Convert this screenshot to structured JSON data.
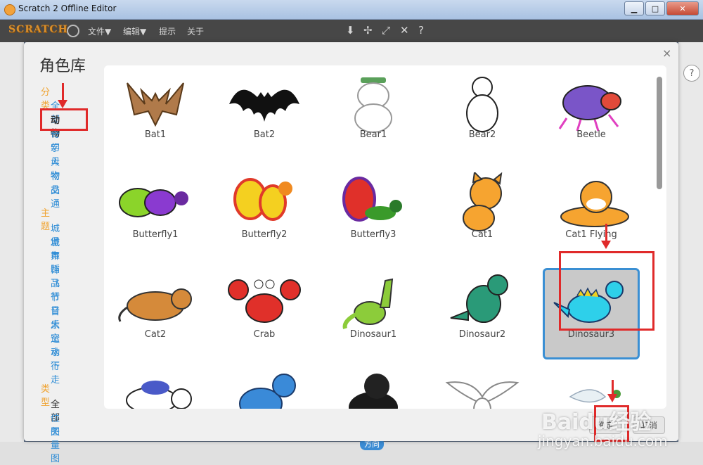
{
  "window": {
    "title": "Scratch 2 Offline Editor",
    "minimize": "▁",
    "maximize": "□",
    "close": "✕"
  },
  "menubar": {
    "logo": "SCRATCH",
    "items": [
      "文件▼",
      "编辑▼",
      "提示",
      "关于"
    ]
  },
  "dialog": {
    "title": "角色库",
    "close": "×",
    "category_header": "分类",
    "categories": [
      "全部",
      "动物",
      "奇幻",
      "字母",
      "人物",
      "物品",
      "交通"
    ],
    "selected_category": "动物",
    "theme_header": "主题",
    "themes": [
      "城堡",
      "城市",
      "舞蹈",
      "饰品",
      "飞行",
      "节日",
      "音乐",
      "太空",
      "运动",
      "水下",
      "行走"
    ],
    "type_header": "类型",
    "types": [
      "全部",
      "位图",
      "矢量图"
    ],
    "ok_label": "确定",
    "cancel_label": "取消"
  },
  "sprites": [
    {
      "name": "Bat1",
      "icon": "bat-sprite-icon"
    },
    {
      "name": "Bat2",
      "icon": "bat-silhouette-icon"
    },
    {
      "name": "Bear1",
      "icon": "bear-outline-icon"
    },
    {
      "name": "Bear2",
      "icon": "bear-lineart-icon"
    },
    {
      "name": "Beetle",
      "icon": "beetle-icon"
    },
    {
      "name": "Butterfly1",
      "icon": "butterfly-icon"
    },
    {
      "name": "Butterfly2",
      "icon": "butterfly-icon"
    },
    {
      "name": "Butterfly3",
      "icon": "butterfly-icon"
    },
    {
      "name": "Cat1",
      "icon": "cat-icon"
    },
    {
      "name": "Cat1 Flying",
      "icon": "cat-flying-icon"
    },
    {
      "name": "Cat2",
      "icon": "cat-brown-icon"
    },
    {
      "name": "Crab",
      "icon": "crab-icon"
    },
    {
      "name": "Dinosaur1",
      "icon": "dinosaur-icon"
    },
    {
      "name": "Dinosaur2",
      "icon": "dinosaur-icon"
    },
    {
      "name": "Dinosaur3",
      "icon": "dinosaur-icon"
    },
    {
      "name": "",
      "icon": "dog-icon"
    },
    {
      "name": "",
      "icon": "dog-blue-icon"
    },
    {
      "name": "",
      "icon": "puppy-photo-icon"
    },
    {
      "name": "",
      "icon": "dove-icon"
    },
    {
      "name": "",
      "icon": "dove-branch-icon"
    }
  ],
  "selected_sprite": "Dinosaur3",
  "editor": {
    "direction_badge": "方向",
    "help": "?"
  },
  "watermark": {
    "brand": "Baidu经验",
    "url": "jingyan.baidu.com"
  },
  "colors": {
    "accent": "#3a8fd3",
    "category_header": "#f0a330",
    "link": "#2f8dd6",
    "annotation": "#e02a2a"
  }
}
